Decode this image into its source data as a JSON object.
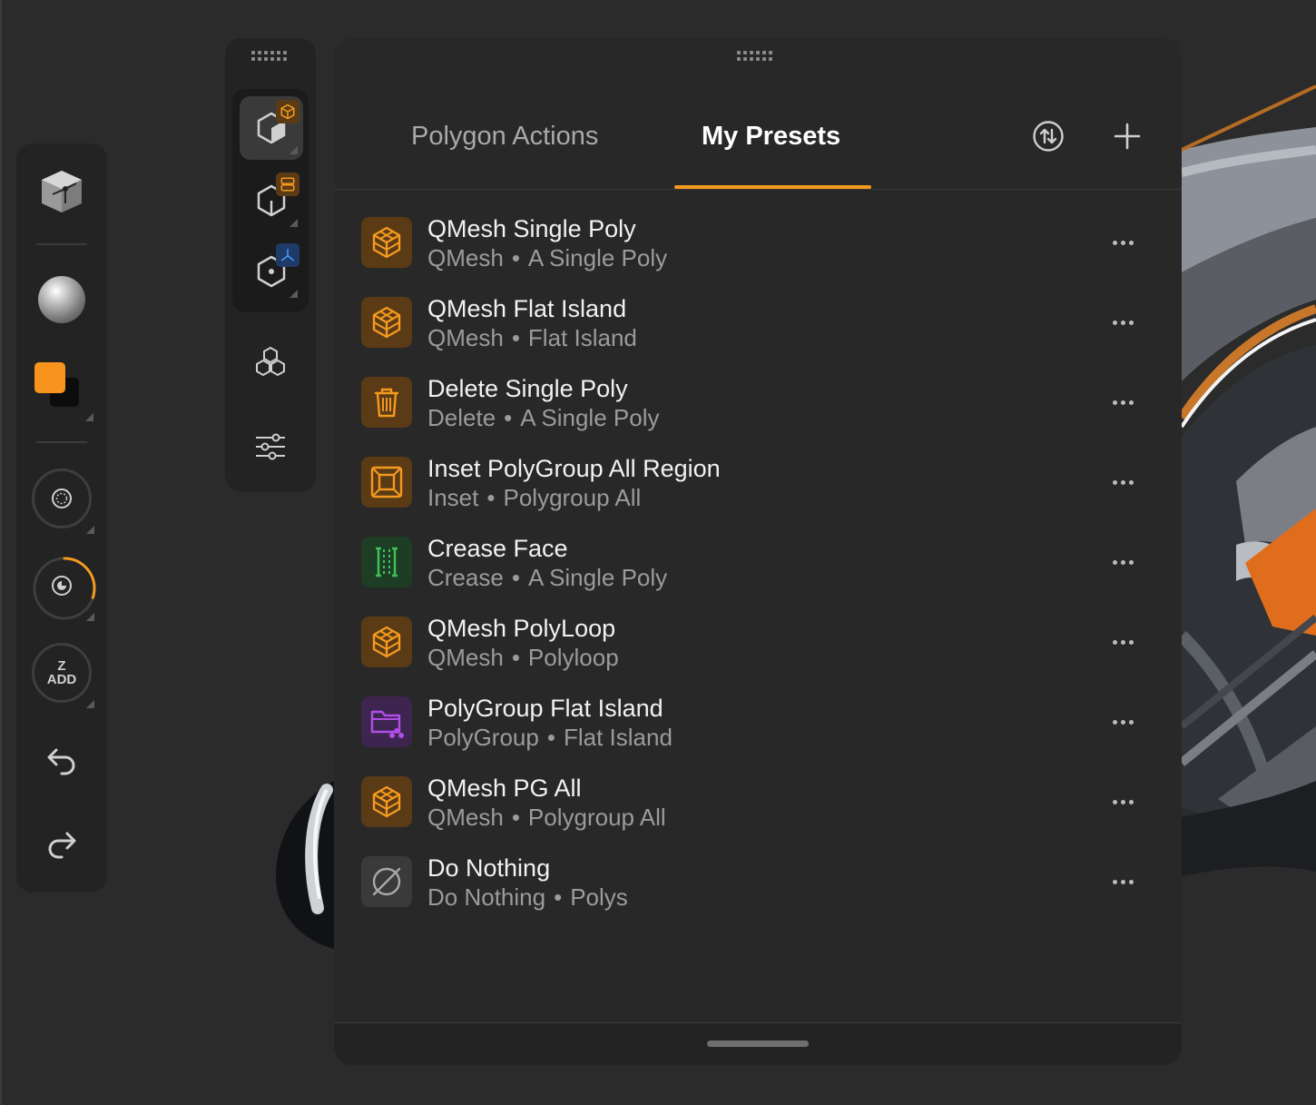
{
  "colors": {
    "accent": "#f39a1f",
    "primary_swatch": "#f7941d",
    "secondary_swatch": "#0c0c0c",
    "qmesh_icon_bg": "#5b3a16",
    "delete_icon_bg": "#5b3a16",
    "inset_icon_bg": "#5b3a16",
    "crease_icon_bg": "#1e3d25",
    "polygroup_icon_bg": "#3d2550",
    "nothing_icon_bg": "#3a3a3a"
  },
  "left_toolbar": {
    "items": [
      "scene-cube-icon",
      "material-sphere",
      "color-swatch",
      "focal-shift-dial",
      "draw-size-dial",
      "zadd-toggle",
      "undo-icon",
      "redo-icon"
    ],
    "zadd": {
      "top": "Z",
      "bottom": "ADD"
    },
    "draw_size_progress": 0.3
  },
  "tool_strip": {
    "modes": [
      "object-mode-icon",
      "polygroup-mode-icon",
      "gizmo-mode-icon"
    ],
    "active_mode": 0,
    "extra": [
      "subtools-icon",
      "sliders-icon"
    ]
  },
  "panel": {
    "tabs": [
      {
        "label": "Polygon Actions",
        "active": false
      },
      {
        "label": "My Presets",
        "active": true
      }
    ],
    "header_icons": [
      "sort-icon",
      "add-icon"
    ],
    "presets": [
      {
        "title": "QMesh Single Poly",
        "category": "QMesh",
        "target": "A Single Poly",
        "icon": "qmesh-icon"
      },
      {
        "title": "QMesh Flat Island",
        "category": "QMesh",
        "target": "Flat Island",
        "icon": "qmesh-icon"
      },
      {
        "title": "Delete Single Poly",
        "category": "Delete",
        "target": "A Single Poly",
        "icon": "trash-icon"
      },
      {
        "title": "Inset PolyGroup All Region",
        "category": "Inset",
        "target": "Polygroup All",
        "icon": "inset-icon"
      },
      {
        "title": "Crease Face",
        "category": "Crease",
        "target": "A Single Poly",
        "icon": "crease-icon"
      },
      {
        "title": "QMesh PolyLoop",
        "category": "QMesh",
        "target": "Polyloop",
        "icon": "qmesh-icon"
      },
      {
        "title": "PolyGroup Flat Island",
        "category": "PolyGroup",
        "target": "Flat Island",
        "icon": "polygroup-folder-icon"
      },
      {
        "title": "QMesh PG All",
        "category": "QMesh",
        "target": "Polygroup All",
        "icon": "qmesh-icon"
      },
      {
        "title": "Do Nothing",
        "category": "Do Nothing",
        "target": "Polys",
        "icon": "do-nothing-icon"
      }
    ],
    "separator": "•"
  }
}
